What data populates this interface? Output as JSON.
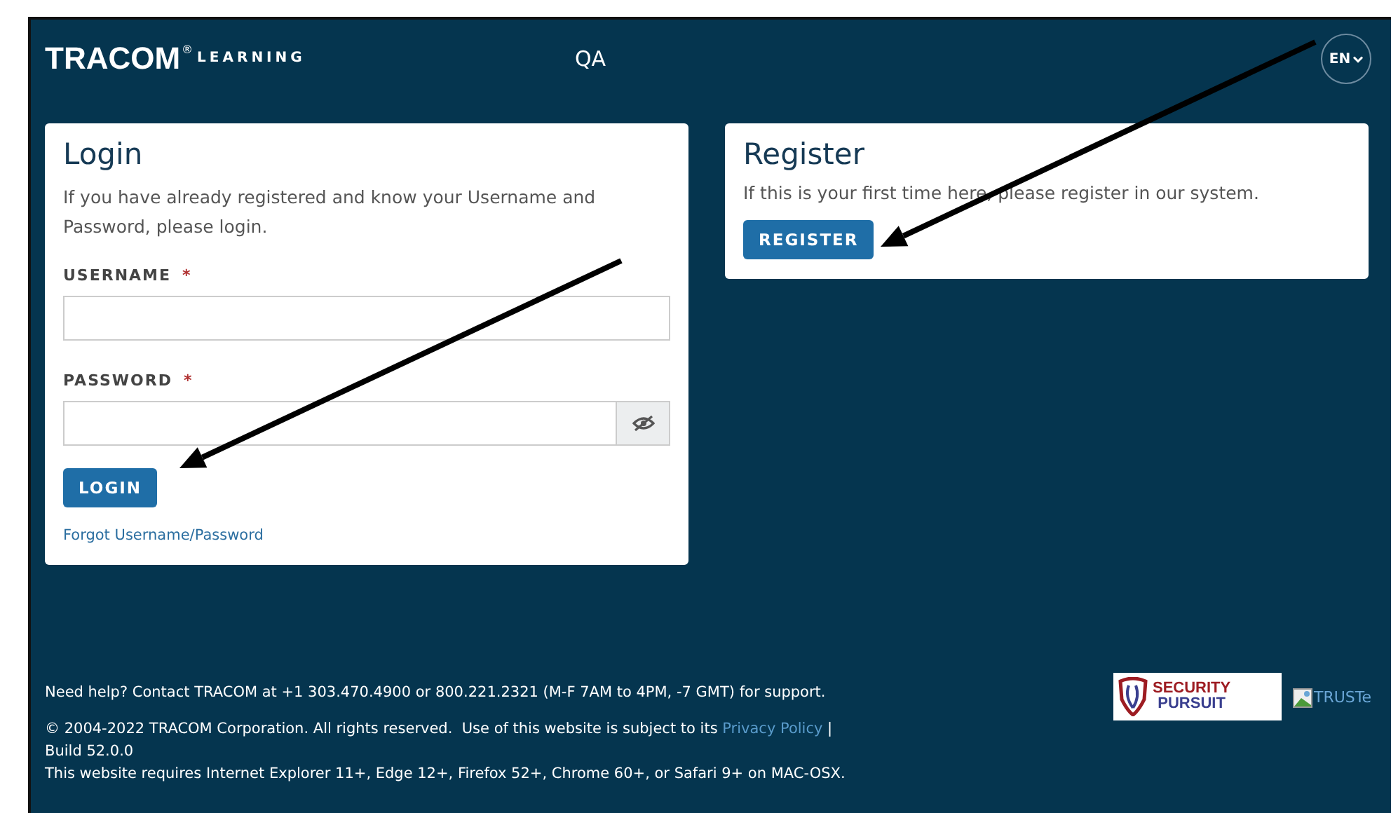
{
  "header": {
    "brand": "TRACOM",
    "brand_mark": "®",
    "brand_sub": "LEARNING",
    "environment": "QA",
    "language": "EN"
  },
  "login": {
    "title": "Login",
    "intro": "If you have already registered and know your Username and Password, please login.",
    "fields": [
      {
        "label": "USERNAME",
        "required_mark": "*",
        "kind": "text"
      },
      {
        "label": "PASSWORD",
        "required_mark": "*",
        "kind": "password"
      }
    ],
    "button": "LOGIN",
    "forgot_link": "Forgot Username/Password"
  },
  "register": {
    "title": "Register",
    "intro": "If this is your first time here, please register in our system.",
    "button": "REGISTER"
  },
  "footer": {
    "help": "Need help? Contact TRACOM at +1 303.470.4900 or 800.221.2321 (M-F 7AM to 4PM, -7 GMT) for support.",
    "copyright": "© 2004-2022 TRACOM Corporation. All rights reserved.  Use of this website is subject to its",
    "privacy_link": "Privacy Policy",
    "separator": "|",
    "build": "Build 52.0.0",
    "requirements": "This website requires Internet Explorer 11+, Edge 12+, Firefox 52+, Chrome 60+, or Safari 9+ on MAC-OSX.",
    "security_logo": {
      "line_1": "SECURITY",
      "line_2": "PURSUIT"
    },
    "truste_alt": "TRUSTe"
  },
  "annotations": [
    {
      "kind": "arrow"
    },
    {
      "kind": "arrow"
    }
  ]
}
